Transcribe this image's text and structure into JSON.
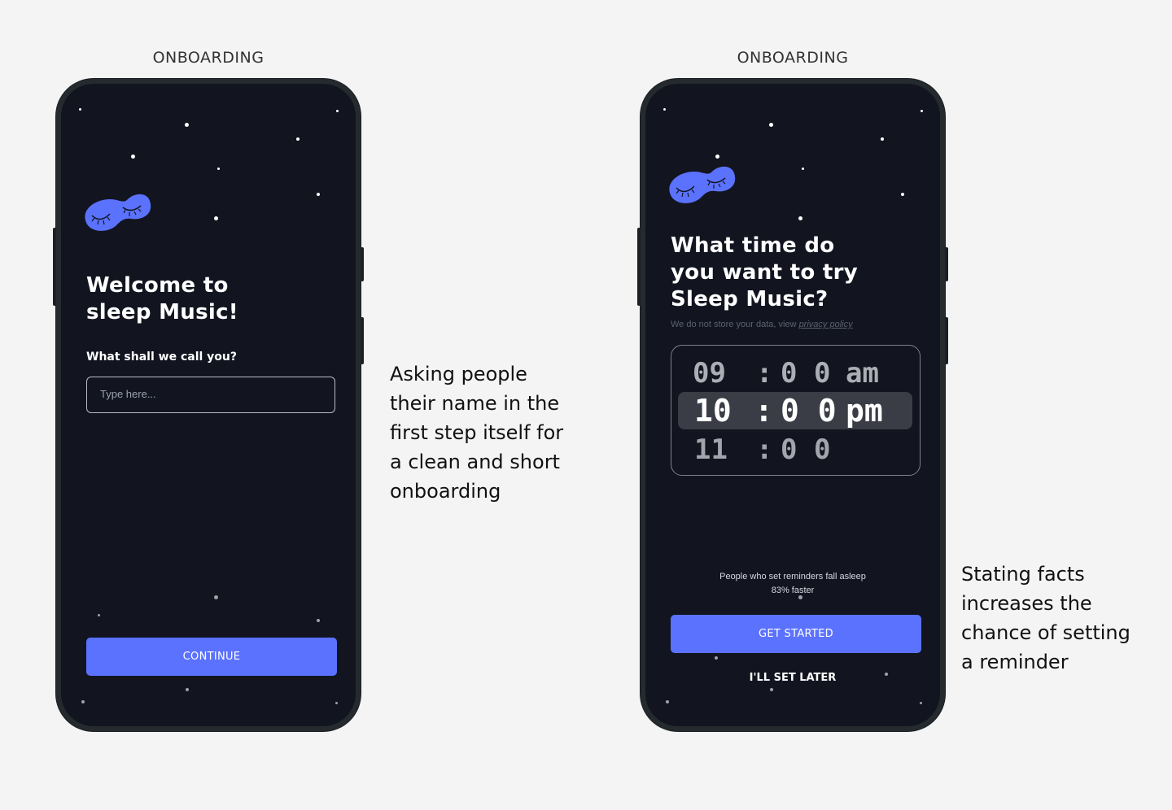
{
  "screens": [
    {
      "caption": "ONBOARDING",
      "icon": "sleep-mask-icon",
      "title_line1": "Welcome to",
      "title_line2": "sleep Music!",
      "question": "What shall we call you?",
      "name_input": {
        "value": "",
        "placeholder": "Type here..."
      },
      "continue_label": "CONTINUE"
    },
    {
      "caption": "ONBOARDING",
      "icon": "sleep-mask-icon",
      "title_line1": "What time do",
      "title_line2": "you want to try",
      "title_line3": "Sleep Music?",
      "privacy_text": "We do not store your data, view",
      "privacy_link": "privacy policy",
      "time_picker": {
        "rows": [
          {
            "hour": "09",
            "sep": ":",
            "minute": "0 0",
            "period": "am"
          },
          {
            "hour": "10",
            "sep": ":",
            "minute": "0 0",
            "period": "pm"
          },
          {
            "hour": "11",
            "sep": ":",
            "minute": "0 0",
            "period": ""
          }
        ],
        "selected": "10 : 00 pm"
      },
      "fact_line1": "People who set reminders fall asleep",
      "fact_line2": "83% faster",
      "get_started_label": "GET STARTED",
      "later_label": "I'LL SET LATER"
    }
  ],
  "notes": {
    "left": [
      "Asking people",
      "their name in the",
      "first step itself for",
      "a clean and  short",
      "onboarding"
    ],
    "right": [
      "Stating facts",
      "increases the",
      "chance of setting",
      "a reminder"
    ]
  },
  "colors": {
    "background": "#f4f4f4",
    "screen": "#121520",
    "accent": "#5b72ff",
    "mask": "#5b72ff"
  }
}
